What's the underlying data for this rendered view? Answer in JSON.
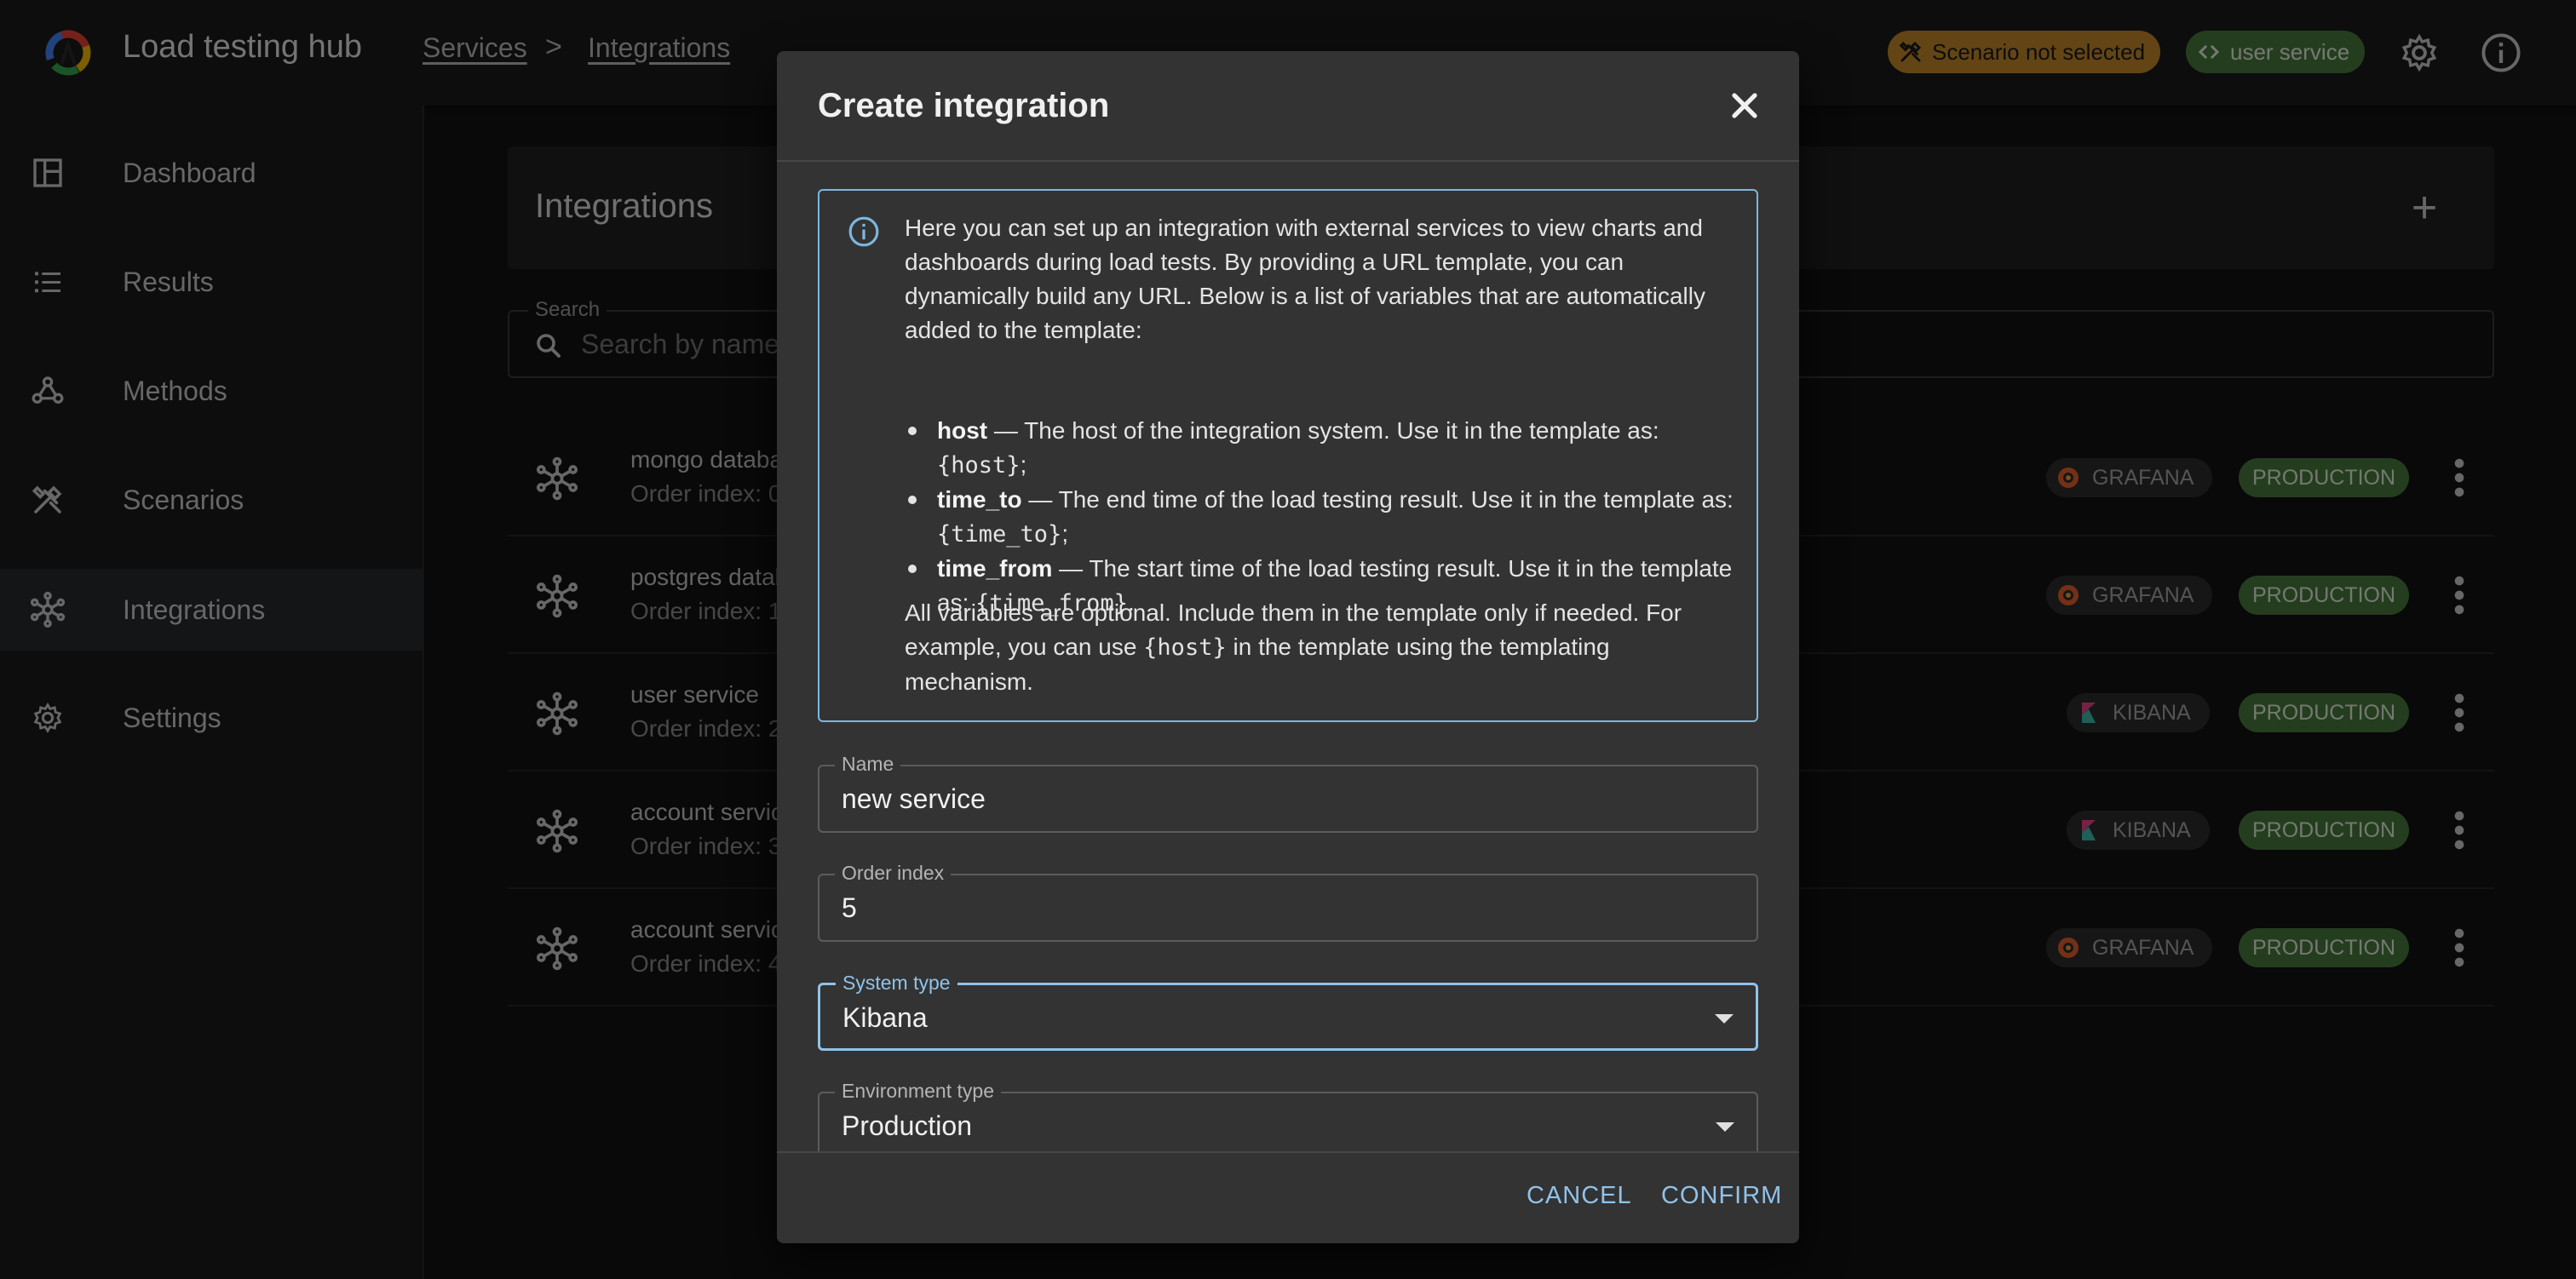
{
  "header": {
    "app_title": "Load testing hub",
    "breadcrumb": [
      "Services",
      "Integrations"
    ],
    "breadcrumb_separator": ">",
    "scenario_chip": "Scenario not selected",
    "service_chip": "user service"
  },
  "sidebar": {
    "items": [
      {
        "label": "Dashboard",
        "icon": "dashboard-icon"
      },
      {
        "label": "Results",
        "icon": "list-icon"
      },
      {
        "label": "Methods",
        "icon": "webhook-icon"
      },
      {
        "label": "Scenarios",
        "icon": "tools-icon"
      },
      {
        "label": "Integrations",
        "icon": "hub-icon",
        "active": true
      },
      {
        "label": "Settings",
        "icon": "gear-icon"
      }
    ]
  },
  "main": {
    "title": "Integrations",
    "search_label": "Search",
    "search_placeholder": "Search by name",
    "rows": [
      {
        "name": "mongo database",
        "order": "Order index: 0",
        "system": "GRAFANA",
        "environment": "PRODUCTION"
      },
      {
        "name": "postgres database",
        "order": "Order index: 1",
        "system": "GRAFANA",
        "environment": "PRODUCTION"
      },
      {
        "name": "user service",
        "order": "Order index: 2",
        "system": "KIBANA",
        "environment": "PRODUCTION"
      },
      {
        "name": "account service",
        "order": "Order index: 3",
        "system": "KIBANA",
        "environment": "PRODUCTION"
      },
      {
        "name": "account service",
        "order": "Order index: 4",
        "system": "GRAFANA",
        "environment": "PRODUCTION"
      }
    ]
  },
  "dialog": {
    "title": "Create integration",
    "info": {
      "intro": "Here you can set up an integration with external services to view charts and dashboards during load tests. By providing a URL template, you can dynamically build any URL. Below is a list of variables that are automatically added to the template:",
      "variables": [
        {
          "name": "host",
          "text": " — The host of the integration system. Use it in the template as: ",
          "code": "{host}",
          "end": ";"
        },
        {
          "name": "time_to",
          "text": " — The end time of the load testing result. Use it in the template as: ",
          "code": "{time_to}",
          "end": ";"
        },
        {
          "name": "time_from",
          "text": " — The start time of the load testing result. Use it in the template as: ",
          "code": "{time_from}",
          "end": "."
        }
      ],
      "footer_a": "All variables are optional. Include them in the template only if needed. For example, you can use ",
      "footer_code": "{host}",
      "footer_b": " in the template using the templating mechanism."
    },
    "fields": {
      "name": {
        "label": "Name",
        "value": "new service"
      },
      "order_index": {
        "label": "Order index",
        "value": "5"
      },
      "system_type": {
        "label": "System type",
        "value": "Kibana"
      },
      "environment_type": {
        "label": "Environment type",
        "value": "Production"
      }
    },
    "cancel_label": "CANCEL",
    "confirm_label": "CONFIRM"
  },
  "colors": {
    "accent": "#90c2ea",
    "warning_chip": "#c68b2b",
    "success_chip": "#4a7a3e"
  }
}
